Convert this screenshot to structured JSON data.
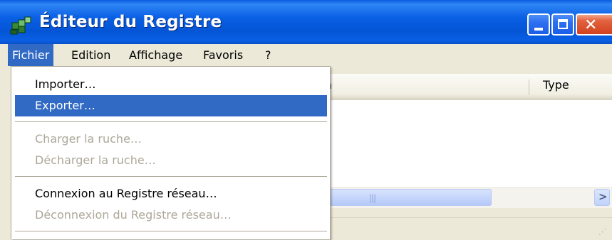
{
  "window": {
    "title": "Éditeur du Registre"
  },
  "menubar": {
    "items": [
      {
        "label": "Fichier",
        "active": true
      },
      {
        "label": "Edition"
      },
      {
        "label": "Affichage"
      },
      {
        "label": "Favoris"
      },
      {
        "label": "?"
      }
    ]
  },
  "list": {
    "header_partial": "n",
    "header_type": "Type"
  },
  "file_menu": {
    "items": [
      {
        "label": "Importer…",
        "state": "normal"
      },
      {
        "label": "Exporter…",
        "state": "highlighted"
      },
      {
        "label": "Charger la ruche…",
        "state": "disabled"
      },
      {
        "label": "Décharger la ruche…",
        "state": "disabled"
      },
      {
        "label": "Connexion au Registre réseau…",
        "state": "normal"
      },
      {
        "label": "Déconnexion du Registre réseau…",
        "state": "disabled"
      }
    ]
  },
  "colors": {
    "titlebar": "#0a5fe4",
    "menu_highlight": "#316ac5",
    "disabled_text": "#aca899",
    "close_button": "#d3421f"
  },
  "icons": {
    "app": "registry-editor-icon",
    "minimize": "minimize-icon",
    "maximize": "maximize-icon",
    "close": "close-icon",
    "scroll_right": "chevron-right-icon"
  }
}
